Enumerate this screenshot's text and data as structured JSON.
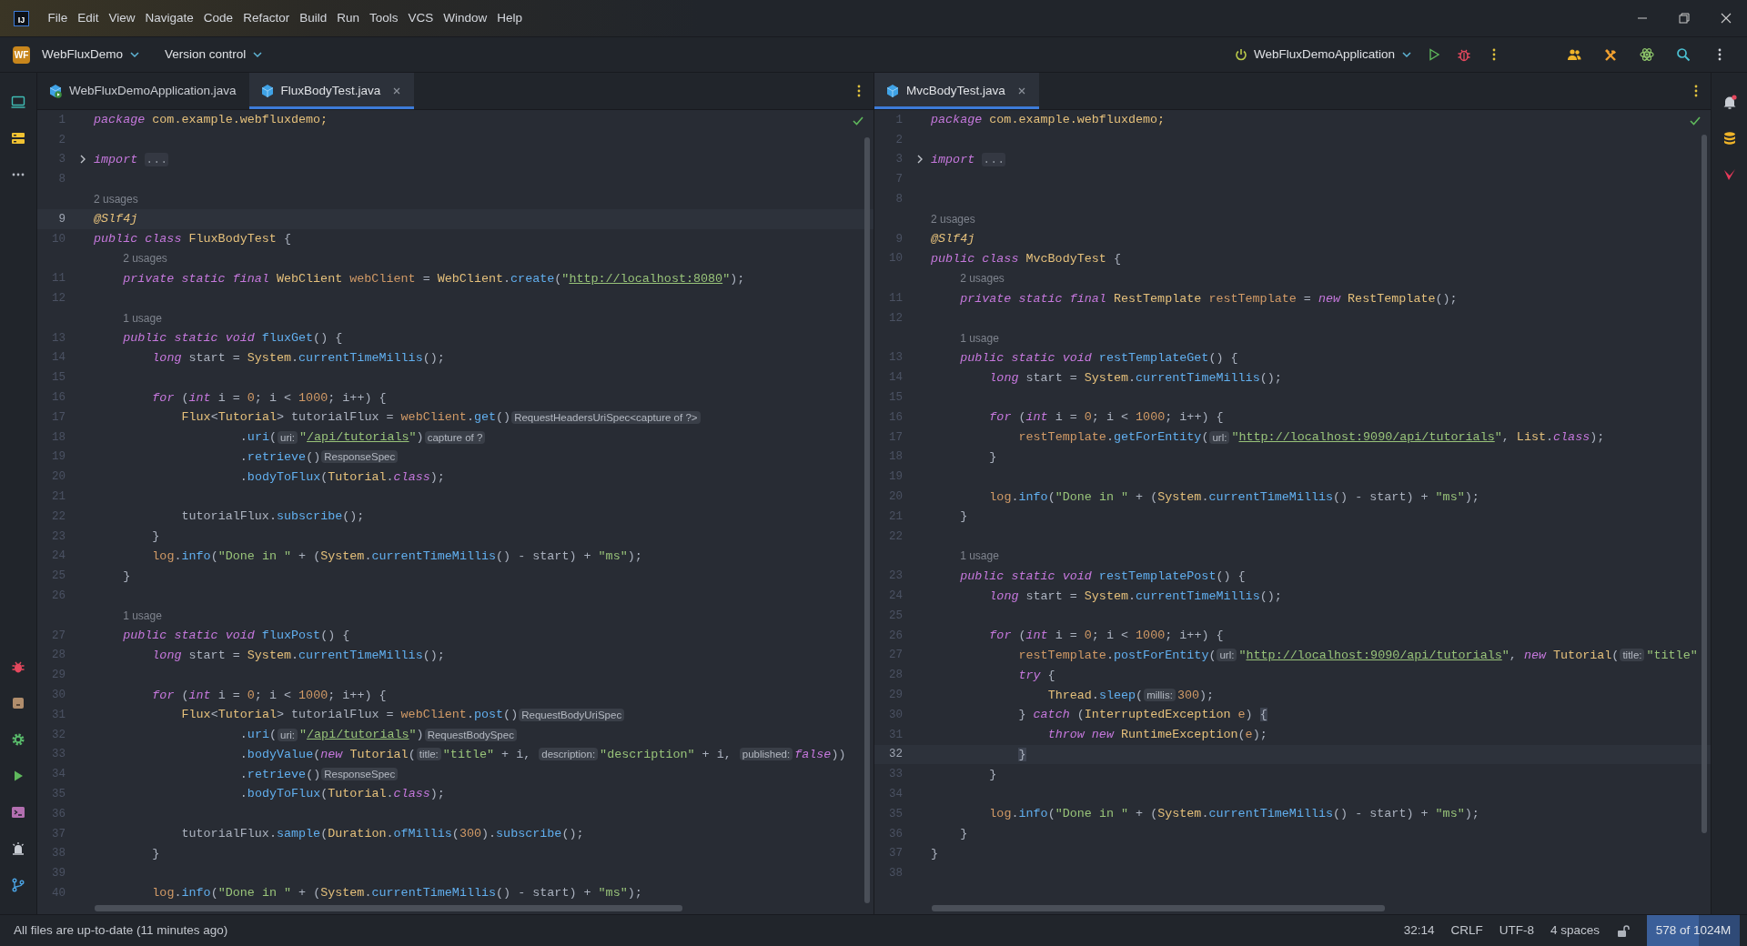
{
  "app_badge": "IJ",
  "menu_bar": {
    "items": [
      "File",
      "Edit",
      "View",
      "Navigate",
      "Code",
      "Refactor",
      "Build",
      "Run",
      "Tools",
      "VCS",
      "Window",
      "Help"
    ]
  },
  "toolbar": {
    "project_badge": "WF",
    "project": "WebFluxDemo",
    "vcs": "Version control",
    "run_config": "WebFluxDemoApplication"
  },
  "editors": [
    {
      "tabs": [
        {
          "label": "WebFluxDemoApplication.java",
          "kind": "runnable",
          "selected": false
        },
        {
          "label": "FluxBodyTest.java",
          "kind": "class",
          "selected": true
        }
      ],
      "lines": [
        {
          "kind": "code",
          "number": "1",
          "parts": [
            {
              "kind": "keyword",
              "text": "package "
            },
            {
              "kind": "type",
              "text": "com.example.webfluxdemo;"
            }
          ]
        },
        {
          "kind": "code",
          "number": "2"
        },
        {
          "kind": "folded",
          "number": "3",
          "parts": [
            {
              "kind": "keyword",
              "text": "import "
            },
            {
              "kind": "fold",
              "text": "..."
            }
          ]
        },
        {
          "kind": "code",
          "number": "8"
        },
        {
          "kind": "usage",
          "text": "2 usages"
        },
        {
          "kind": "caret",
          "number": "9",
          "parts": [
            {
              "kind": "annotation",
              "text": "@Slf4j"
            }
          ]
        },
        {
          "kind": "code",
          "number": "10",
          "parts": [
            {
              "kind": "keyword",
              "text": "public class "
            },
            {
              "kind": "type",
              "text": "FluxBodyTest"
            },
            {
              "kind": "plain",
              "text": " {"
            }
          ]
        },
        {
          "kind": "usage",
          "text": "    2 usages"
        },
        {
          "kind": "code",
          "number": "11",
          "parts": [
            {
              "kind": "keyword",
              "text": "    private static final "
            },
            {
              "kind": "type",
              "text": "WebClient "
            },
            {
              "kind": "field",
              "text": "webClient"
            },
            {
              "kind": "plain",
              "text": " = "
            },
            {
              "kind": "type",
              "text": "WebClient"
            },
            {
              "kind": "plain",
              "text": "."
            },
            {
              "kind": "method",
              "text": "create"
            },
            {
              "kind": "plain",
              "text": "("
            },
            {
              "kind": "string",
              "text": "\""
            },
            {
              "kind": "link",
              "text": "http://localhost:8080"
            },
            {
              "kind": "string",
              "text": "\""
            },
            {
              "kind": "plain",
              "text": ");"
            }
          ]
        },
        {
          "kind": "code",
          "number": "12"
        },
        {
          "kind": "usage",
          "text": "    1 usage"
        },
        {
          "kind": "code",
          "number": "13",
          "parts": [
            {
              "kind": "keyword",
              "text": "    public static void "
            },
            {
              "kind": "method",
              "text": "fluxGet"
            },
            {
              "kind": "plain",
              "text": "() {"
            }
          ]
        },
        {
          "kind": "code",
          "number": "14",
          "parts": [
            {
              "kind": "keyword",
              "text": "        long "
            },
            {
              "kind": "plain",
              "text": "start = "
            },
            {
              "kind": "type",
              "text": "System"
            },
            {
              "kind": "plain",
              "text": "."
            },
            {
              "kind": "method",
              "text": "currentTimeMillis"
            },
            {
              "kind": "plain",
              "text": "();"
            }
          ]
        },
        {
          "kind": "code",
          "number": "15"
        },
        {
          "kind": "code",
          "number": "16",
          "parts": [
            {
              "kind": "keyword",
              "text": "        for"
            },
            {
              "kind": "plain",
              "text": " ("
            },
            {
              "kind": "keyword",
              "text": "int "
            },
            {
              "kind": "plain",
              "text": "i = "
            },
            {
              "kind": "number",
              "text": "0"
            },
            {
              "kind": "plain",
              "text": "; i < "
            },
            {
              "kind": "number",
              "text": "1000"
            },
            {
              "kind": "plain",
              "text": "; i++) {"
            }
          ]
        },
        {
          "kind": "code",
          "number": "17",
          "parts": [
            {
              "kind": "type",
              "text": "            Flux"
            },
            {
              "kind": "plain",
              "text": "<"
            },
            {
              "kind": "type",
              "text": "Tutorial"
            },
            {
              "kind": "plain",
              "text": "> tutorialFlux = "
            },
            {
              "kind": "field",
              "text": "webClient"
            },
            {
              "kind": "plain",
              "text": "."
            },
            {
              "kind": "method",
              "text": "get"
            },
            {
              "kind": "plain",
              "text": "()"
            },
            {
              "kind": "hint",
              "text": "RequestHeadersUriSpec<capture of ?>"
            }
          ]
        },
        {
          "kind": "code",
          "number": "18",
          "parts": [
            {
              "kind": "plain",
              "text": "                    ."
            },
            {
              "kind": "method",
              "text": "uri"
            },
            {
              "kind": "plain",
              "text": "("
            },
            {
              "kind": "hint",
              "text": "uri:"
            },
            {
              "kind": "string",
              "text": "\""
            },
            {
              "kind": "link",
              "text": "/api/tutorials"
            },
            {
              "kind": "string",
              "text": "\""
            },
            {
              "kind": "plain",
              "text": ")"
            },
            {
              "kind": "hint",
              "text": "capture of ?"
            }
          ]
        },
        {
          "kind": "code",
          "number": "19",
          "parts": [
            {
              "kind": "plain",
              "text": "                    ."
            },
            {
              "kind": "method",
              "text": "retrieve"
            },
            {
              "kind": "plain",
              "text": "()"
            },
            {
              "kind": "hint",
              "text": "ResponseSpec"
            }
          ]
        },
        {
          "kind": "code",
          "number": "20",
          "parts": [
            {
              "kind": "plain",
              "text": "                    ."
            },
            {
              "kind": "method",
              "text": "bodyToFlux"
            },
            {
              "kind": "plain",
              "text": "("
            },
            {
              "kind": "type",
              "text": "Tutorial"
            },
            {
              "kind": "plain",
              "text": "."
            },
            {
              "kind": "keyword",
              "text": "class"
            },
            {
              "kind": "plain",
              "text": ");"
            }
          ]
        },
        {
          "kind": "code",
          "number": "21"
        },
        {
          "kind": "code",
          "number": "22",
          "parts": [
            {
              "kind": "plain",
              "text": "            tutorialFlux."
            },
            {
              "kind": "method",
              "text": "subscribe"
            },
            {
              "kind": "plain",
              "text": "();"
            }
          ]
        },
        {
          "kind": "code",
          "number": "23",
          "parts": [
            {
              "kind": "plain",
              "text": "        }"
            }
          ]
        },
        {
          "kind": "code",
          "number": "24",
          "parts": [
            {
              "kind": "field",
              "text": "        log"
            },
            {
              "kind": "plain",
              "text": "."
            },
            {
              "kind": "method",
              "text": "info"
            },
            {
              "kind": "plain",
              "text": "("
            },
            {
              "kind": "string",
              "text": "\"Done in \""
            },
            {
              "kind": "plain",
              "text": " + ("
            },
            {
              "kind": "type",
              "text": "System"
            },
            {
              "kind": "plain",
              "text": "."
            },
            {
              "kind": "method",
              "text": "currentTimeMillis"
            },
            {
              "kind": "plain",
              "text": "() - start) + "
            },
            {
              "kind": "string",
              "text": "\"ms\""
            },
            {
              "kind": "plain",
              "text": ");"
            }
          ]
        },
        {
          "kind": "code",
          "number": "25",
          "parts": [
            {
              "kind": "plain",
              "text": "    }"
            }
          ]
        },
        {
          "kind": "code",
          "number": "26"
        },
        {
          "kind": "usage",
          "text": "    1 usage"
        },
        {
          "kind": "code",
          "number": "27",
          "parts": [
            {
              "kind": "keyword",
              "text": "    public static void "
            },
            {
              "kind": "method",
              "text": "fluxPost"
            },
            {
              "kind": "plain",
              "text": "() {"
            }
          ]
        },
        {
          "kind": "code",
          "number": "28",
          "parts": [
            {
              "kind": "keyword",
              "text": "        long "
            },
            {
              "kind": "plain",
              "text": "start = "
            },
            {
              "kind": "type",
              "text": "System"
            },
            {
              "kind": "plain",
              "text": "."
            },
            {
              "kind": "method",
              "text": "currentTimeMillis"
            },
            {
              "kind": "plain",
              "text": "();"
            }
          ]
        },
        {
          "kind": "code",
          "number": "29"
        },
        {
          "kind": "code",
          "number": "30",
          "parts": [
            {
              "kind": "keyword",
              "text": "        for"
            },
            {
              "kind": "plain",
              "text": " ("
            },
            {
              "kind": "keyword",
              "text": "int "
            },
            {
              "kind": "plain",
              "text": "i = "
            },
            {
              "kind": "number",
              "text": "0"
            },
            {
              "kind": "plain",
              "text": "; i < "
            },
            {
              "kind": "number",
              "text": "1000"
            },
            {
              "kind": "plain",
              "text": "; i++) {"
            }
          ]
        },
        {
          "kind": "code",
          "number": "31",
          "parts": [
            {
              "kind": "type",
              "text": "            Flux"
            },
            {
              "kind": "plain",
              "text": "<"
            },
            {
              "kind": "type",
              "text": "Tutorial"
            },
            {
              "kind": "plain",
              "text": "> tutorialFlux = "
            },
            {
              "kind": "field",
              "text": "webClient"
            },
            {
              "kind": "plain",
              "text": "."
            },
            {
              "kind": "method",
              "text": "post"
            },
            {
              "kind": "plain",
              "text": "()"
            },
            {
              "kind": "hint",
              "text": "RequestBodyUriSpec"
            }
          ]
        },
        {
          "kind": "code",
          "number": "32",
          "parts": [
            {
              "kind": "plain",
              "text": "                    ."
            },
            {
              "kind": "method",
              "text": "uri"
            },
            {
              "kind": "plain",
              "text": "("
            },
            {
              "kind": "hint",
              "text": "uri:"
            },
            {
              "kind": "string",
              "text": "\""
            },
            {
              "kind": "link",
              "text": "/api/tutorials"
            },
            {
              "kind": "string",
              "text": "\""
            },
            {
              "kind": "plain",
              "text": ")"
            },
            {
              "kind": "hint",
              "text": "RequestBodySpec"
            }
          ]
        },
        {
          "kind": "code",
          "number": "33",
          "parts": [
            {
              "kind": "plain",
              "text": "                    ."
            },
            {
              "kind": "method",
              "text": "bodyValue"
            },
            {
              "kind": "plain",
              "text": "("
            },
            {
              "kind": "keyword",
              "text": "new "
            },
            {
              "kind": "type",
              "text": "Tutorial"
            },
            {
              "kind": "plain",
              "text": "("
            },
            {
              "kind": "hint",
              "text": "title:"
            },
            {
              "kind": "string",
              "text": "\"title\""
            },
            {
              "kind": "plain",
              "text": " + i, "
            },
            {
              "kind": "hint",
              "text": "description:"
            },
            {
              "kind": "string",
              "text": "\"description\""
            },
            {
              "kind": "plain",
              "text": " + i, "
            },
            {
              "kind": "hint",
              "text": "published:"
            },
            {
              "kind": "keyword",
              "text": "false"
            },
            {
              "kind": "plain",
              "text": "))"
            }
          ]
        },
        {
          "kind": "code",
          "number": "34",
          "parts": [
            {
              "kind": "plain",
              "text": "                    ."
            },
            {
              "kind": "method",
              "text": "retrieve"
            },
            {
              "kind": "plain",
              "text": "()"
            },
            {
              "kind": "hint",
              "text": "ResponseSpec"
            }
          ]
        },
        {
          "kind": "code",
          "number": "35",
          "parts": [
            {
              "kind": "plain",
              "text": "                    ."
            },
            {
              "kind": "method",
              "text": "bodyToFlux"
            },
            {
              "kind": "plain",
              "text": "("
            },
            {
              "kind": "type",
              "text": "Tutorial"
            },
            {
              "kind": "plain",
              "text": "."
            },
            {
              "kind": "keyword",
              "text": "class"
            },
            {
              "kind": "plain",
              "text": ");"
            }
          ]
        },
        {
          "kind": "code",
          "number": "36"
        },
        {
          "kind": "code",
          "number": "37",
          "parts": [
            {
              "kind": "plain",
              "text": "            tutorialFlux."
            },
            {
              "kind": "method",
              "text": "sample"
            },
            {
              "kind": "plain",
              "text": "("
            },
            {
              "kind": "type",
              "text": "Duration"
            },
            {
              "kind": "plain",
              "text": "."
            },
            {
              "kind": "method",
              "text": "ofMillis"
            },
            {
              "kind": "plain",
              "text": "("
            },
            {
              "kind": "number",
              "text": "300"
            },
            {
              "kind": "plain",
              "text": ")."
            },
            {
              "kind": "method",
              "text": "subscribe"
            },
            {
              "kind": "plain",
              "text": "();"
            }
          ]
        },
        {
          "kind": "code",
          "number": "38",
          "parts": [
            {
              "kind": "plain",
              "text": "        }"
            }
          ]
        },
        {
          "kind": "code",
          "number": "39"
        },
        {
          "kind": "code",
          "number": "40",
          "parts": [
            {
              "kind": "field",
              "text": "        log"
            },
            {
              "kind": "plain",
              "text": "."
            },
            {
              "kind": "method",
              "text": "info"
            },
            {
              "kind": "plain",
              "text": "("
            },
            {
              "kind": "string",
              "text": "\"Done in \""
            },
            {
              "kind": "plain",
              "text": " + ("
            },
            {
              "kind": "type",
              "text": "System"
            },
            {
              "kind": "plain",
              "text": "."
            },
            {
              "kind": "method",
              "text": "currentTimeMillis"
            },
            {
              "kind": "plain",
              "text": "() - start) + "
            },
            {
              "kind": "string",
              "text": "\"ms\""
            },
            {
              "kind": "plain",
              "text": ");"
            }
          ]
        }
      ]
    },
    {
      "tabs": [
        {
          "label": "MvcBodyTest.java",
          "kind": "class",
          "selected": true
        }
      ],
      "lines": [
        {
          "kind": "code",
          "number": "1",
          "parts": [
            {
              "kind": "keyword",
              "text": "package "
            },
            {
              "kind": "type",
              "text": "com.example.webfluxdemo;"
            }
          ]
        },
        {
          "kind": "code",
          "number": "2"
        },
        {
          "kind": "folded",
          "number": "3",
          "parts": [
            {
              "kind": "keyword",
              "text": "import "
            },
            {
              "kind": "fold",
              "text": "..."
            }
          ]
        },
        {
          "kind": "code",
          "number": "7"
        },
        {
          "kind": "code",
          "number": "8"
        },
        {
          "kind": "usage",
          "text": "2 usages"
        },
        {
          "kind": "code",
          "number": "9",
          "parts": [
            {
              "kind": "annotation",
              "text": "@Slf4j"
            }
          ]
        },
        {
          "kind": "code",
          "number": "10",
          "parts": [
            {
              "kind": "keyword",
              "text": "public class "
            },
            {
              "kind": "type",
              "text": "MvcBodyTest"
            },
            {
              "kind": "plain",
              "text": " {"
            }
          ]
        },
        {
          "kind": "usage",
          "text": "    2 usages"
        },
        {
          "kind": "code",
          "number": "11",
          "parts": [
            {
              "kind": "keyword",
              "text": "    private static final "
            },
            {
              "kind": "type",
              "text": "RestTemplate "
            },
            {
              "kind": "field",
              "text": "restTemplate"
            },
            {
              "kind": "plain",
              "text": " = "
            },
            {
              "kind": "keyword",
              "text": "new "
            },
            {
              "kind": "type",
              "text": "RestTemplate"
            },
            {
              "kind": "plain",
              "text": "();"
            }
          ]
        },
        {
          "kind": "code",
          "number": "12"
        },
        {
          "kind": "usage",
          "text": "    1 usage"
        },
        {
          "kind": "code",
          "number": "13",
          "parts": [
            {
              "kind": "keyword",
              "text": "    public static void "
            },
            {
              "kind": "method",
              "text": "restTemplateGet"
            },
            {
              "kind": "plain",
              "text": "() {"
            }
          ]
        },
        {
          "kind": "code",
          "number": "14",
          "parts": [
            {
              "kind": "keyword",
              "text": "        long "
            },
            {
              "kind": "plain",
              "text": "start = "
            },
            {
              "kind": "type",
              "text": "System"
            },
            {
              "kind": "plain",
              "text": "."
            },
            {
              "kind": "method",
              "text": "currentTimeMillis"
            },
            {
              "kind": "plain",
              "text": "();"
            }
          ]
        },
        {
          "kind": "code",
          "number": "15"
        },
        {
          "kind": "code",
          "number": "16",
          "parts": [
            {
              "kind": "keyword",
              "text": "        for"
            },
            {
              "kind": "plain",
              "text": " ("
            },
            {
              "kind": "keyword",
              "text": "int "
            },
            {
              "kind": "plain",
              "text": "i = "
            },
            {
              "kind": "number",
              "text": "0"
            },
            {
              "kind": "plain",
              "text": "; i < "
            },
            {
              "kind": "number",
              "text": "1000"
            },
            {
              "kind": "plain",
              "text": "; i++) {"
            }
          ]
        },
        {
          "kind": "code",
          "number": "17",
          "parts": [
            {
              "kind": "field",
              "text": "            restTemplate"
            },
            {
              "kind": "plain",
              "text": "."
            },
            {
              "kind": "method",
              "text": "getForEntity"
            },
            {
              "kind": "plain",
              "text": "("
            },
            {
              "kind": "hint",
              "text": "url:"
            },
            {
              "kind": "string",
              "text": "\""
            },
            {
              "kind": "link",
              "text": "http://localhost:9090/api/tutorials"
            },
            {
              "kind": "string",
              "text": "\""
            },
            {
              "kind": "plain",
              "text": ", "
            },
            {
              "kind": "type",
              "text": "List"
            },
            {
              "kind": "plain",
              "text": "."
            },
            {
              "kind": "keyword",
              "text": "class"
            },
            {
              "kind": "plain",
              "text": ");"
            }
          ]
        },
        {
          "kind": "code",
          "number": "18",
          "parts": [
            {
              "kind": "plain",
              "text": "        }"
            }
          ]
        },
        {
          "kind": "code",
          "number": "19"
        },
        {
          "kind": "code",
          "number": "20",
          "parts": [
            {
              "kind": "field",
              "text": "        log"
            },
            {
              "kind": "plain",
              "text": "."
            },
            {
              "kind": "method",
              "text": "info"
            },
            {
              "kind": "plain",
              "text": "("
            },
            {
              "kind": "string",
              "text": "\"Done in \""
            },
            {
              "kind": "plain",
              "text": " + ("
            },
            {
              "kind": "type",
              "text": "System"
            },
            {
              "kind": "plain",
              "text": "."
            },
            {
              "kind": "method",
              "text": "currentTimeMillis"
            },
            {
              "kind": "plain",
              "text": "() - start) + "
            },
            {
              "kind": "string",
              "text": "\"ms\""
            },
            {
              "kind": "plain",
              "text": ");"
            }
          ]
        },
        {
          "kind": "code",
          "number": "21",
          "parts": [
            {
              "kind": "plain",
              "text": "    }"
            }
          ]
        },
        {
          "kind": "code",
          "number": "22"
        },
        {
          "kind": "usage",
          "text": "    1 usage"
        },
        {
          "kind": "code",
          "number": "23",
          "parts": [
            {
              "kind": "keyword",
              "text": "    public static void "
            },
            {
              "kind": "method",
              "text": "restTemplatePost"
            },
            {
              "kind": "plain",
              "text": "() {"
            }
          ]
        },
        {
          "kind": "code",
          "number": "24",
          "parts": [
            {
              "kind": "keyword",
              "text": "        long "
            },
            {
              "kind": "plain",
              "text": "start = "
            },
            {
              "kind": "type",
              "text": "System"
            },
            {
              "kind": "plain",
              "text": "."
            },
            {
              "kind": "method",
              "text": "currentTimeMillis"
            },
            {
              "kind": "plain",
              "text": "();"
            }
          ]
        },
        {
          "kind": "code",
          "number": "25"
        },
        {
          "kind": "code",
          "number": "26",
          "parts": [
            {
              "kind": "keyword",
              "text": "        for"
            },
            {
              "kind": "plain",
              "text": " ("
            },
            {
              "kind": "keyword",
              "text": "int "
            },
            {
              "kind": "plain",
              "text": "i = "
            },
            {
              "kind": "number",
              "text": "0"
            },
            {
              "kind": "plain",
              "text": "; i < "
            },
            {
              "kind": "number",
              "text": "1000"
            },
            {
              "kind": "plain",
              "text": "; i++) {"
            }
          ]
        },
        {
          "kind": "code",
          "number": "27",
          "parts": [
            {
              "kind": "field",
              "text": "            restTemplate"
            },
            {
              "kind": "plain",
              "text": "."
            },
            {
              "kind": "method",
              "text": "postForEntity"
            },
            {
              "kind": "plain",
              "text": "("
            },
            {
              "kind": "hint",
              "text": "url:"
            },
            {
              "kind": "string",
              "text": "\""
            },
            {
              "kind": "link",
              "text": "http://localhost:9090/api/tutorials"
            },
            {
              "kind": "string",
              "text": "\""
            },
            {
              "kind": "plain",
              "text": ", "
            },
            {
              "kind": "keyword",
              "text": "new "
            },
            {
              "kind": "type",
              "text": "Tutorial"
            },
            {
              "kind": "plain",
              "text": "("
            },
            {
              "kind": "hint",
              "text": "title:"
            },
            {
              "kind": "string",
              "text": "\"title\""
            }
          ]
        },
        {
          "kind": "code",
          "number": "28",
          "parts": [
            {
              "kind": "keyword",
              "text": "            try"
            },
            {
              "kind": "plain",
              "text": " {"
            }
          ]
        },
        {
          "kind": "code",
          "number": "29",
          "parts": [
            {
              "kind": "type",
              "text": "                Thread"
            },
            {
              "kind": "plain",
              "text": "."
            },
            {
              "kind": "method",
              "text": "sleep"
            },
            {
              "kind": "plain",
              "text": "("
            },
            {
              "kind": "hint",
              "text": "millis:"
            },
            {
              "kind": "number",
              "text": "300"
            },
            {
              "kind": "plain",
              "text": ");"
            }
          ]
        },
        {
          "kind": "code",
          "number": "30",
          "parts": [
            {
              "kind": "plain",
              "text": "            } "
            },
            {
              "kind": "keyword",
              "text": "catch"
            },
            {
              "kind": "plain",
              "text": " ("
            },
            {
              "kind": "type",
              "text": "InterruptedException "
            },
            {
              "kind": "field",
              "text": "e"
            },
            {
              "kind": "plain",
              "text": ") "
            },
            {
              "kind": "brace",
              "text": "{"
            }
          ]
        },
        {
          "kind": "code",
          "number": "31",
          "parts": [
            {
              "kind": "keyword",
              "text": "                throw new "
            },
            {
              "kind": "type",
              "text": "RuntimeException"
            },
            {
              "kind": "plain",
              "text": "("
            },
            {
              "kind": "field",
              "text": "e"
            },
            {
              "kind": "plain",
              "text": ");"
            }
          ]
        },
        {
          "kind": "caret",
          "number": "32",
          "parts": [
            {
              "kind": "brace",
              "text": "            }"
            }
          ]
        },
        {
          "kind": "code",
          "number": "33",
          "parts": [
            {
              "kind": "plain",
              "text": "        }"
            }
          ]
        },
        {
          "kind": "code",
          "number": "34"
        },
        {
          "kind": "code",
          "number": "35",
          "parts": [
            {
              "kind": "field",
              "text": "        log"
            },
            {
              "kind": "plain",
              "text": "."
            },
            {
              "kind": "method",
              "text": "info"
            },
            {
              "kind": "plain",
              "text": "("
            },
            {
              "kind": "string",
              "text": "\"Done in \""
            },
            {
              "kind": "plain",
              "text": " + ("
            },
            {
              "kind": "type",
              "text": "System"
            },
            {
              "kind": "plain",
              "text": "."
            },
            {
              "kind": "method",
              "text": "currentTimeMillis"
            },
            {
              "kind": "plain",
              "text": "() - start) + "
            },
            {
              "kind": "string",
              "text": "\"ms\""
            },
            {
              "kind": "plain",
              "text": ");"
            }
          ]
        },
        {
          "kind": "code",
          "number": "36",
          "parts": [
            {
              "kind": "plain",
              "text": "    }"
            }
          ]
        },
        {
          "kind": "code",
          "number": "37",
          "parts": [
            {
              "kind": "plain",
              "text": "}"
            }
          ]
        },
        {
          "kind": "code",
          "number": "38"
        }
      ]
    }
  ],
  "status_bar": {
    "message": "All files are up-to-date (11 minutes ago)",
    "position": "32:14",
    "line_separator": "CRLF",
    "encoding": "UTF-8",
    "indent": "4 spaces",
    "memory": {
      "text": "578 of 1024M",
      "level": 0.56
    }
  }
}
